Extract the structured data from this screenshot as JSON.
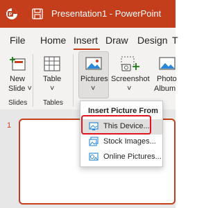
{
  "titlebar": {
    "title": "Presentation1  -  PowerPoint"
  },
  "tabs": [
    {
      "label": "File"
    },
    {
      "label": "Home"
    },
    {
      "label": "Insert",
      "active": true
    },
    {
      "label": "Draw"
    },
    {
      "label": "Design"
    },
    {
      "label": "T"
    }
  ],
  "ribbon": {
    "new_slide": {
      "line1": "New",
      "line2": "Slide ˅",
      "icon": "new-slide-icon"
    },
    "table": {
      "line1": "Table",
      "line2": "˅",
      "icon": "table-icon"
    },
    "pictures": {
      "line1": "Pictures",
      "line2": "˅",
      "icon": "pictures-icon"
    },
    "screenshot": {
      "line1": "Screenshot",
      "line2": "˅",
      "icon": "screenshot-icon"
    },
    "photo_album": {
      "line1": "Photo",
      "line2": "Album",
      "icon": "photo-album-icon"
    },
    "groups": {
      "slides": "Slides",
      "tables": "Tables"
    }
  },
  "slides": {
    "current_number": "1"
  },
  "dropdown": {
    "header": "Insert Picture From",
    "items": [
      {
        "label": "This Device...",
        "icon": "device-picture-icon",
        "highlighted": true
      },
      {
        "label": "Stock Images...",
        "icon": "stock-images-icon"
      },
      {
        "label": "Online Pictures...",
        "icon": "online-pictures-icon"
      }
    ]
  },
  "colors": {
    "brand": "#c43e1c",
    "highlight_box": "#e0141e",
    "ribbon_bg": "#f3f2f1",
    "hover": "#e1dfdd"
  }
}
